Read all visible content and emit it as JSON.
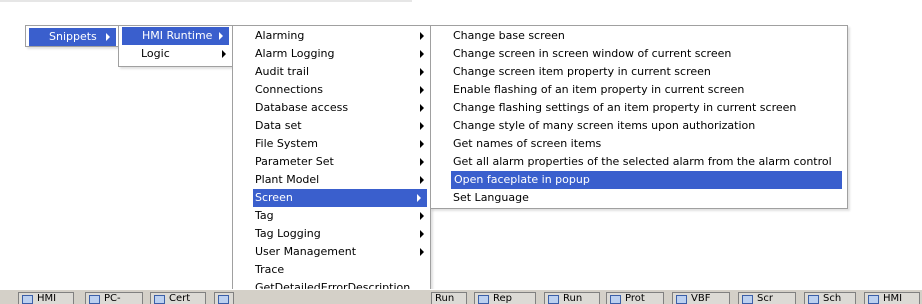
{
  "menus": {
    "snippets": {
      "label": "Snippets"
    },
    "hmi": {
      "items": [
        {
          "label": "HMI Runtime"
        },
        {
          "label": "Logic"
        }
      ]
    },
    "categories": {
      "items": [
        {
          "label": "Alarming"
        },
        {
          "label": "Alarm Logging"
        },
        {
          "label": "Audit trail"
        },
        {
          "label": "Connections"
        },
        {
          "label": "Database access"
        },
        {
          "label": "Data set"
        },
        {
          "label": "File System"
        },
        {
          "label": "Parameter Set"
        },
        {
          "label": "Plant Model"
        },
        {
          "label": "Screen"
        },
        {
          "label": "Tag"
        },
        {
          "label": "Tag Logging"
        },
        {
          "label": "User Management"
        },
        {
          "label": "Trace"
        },
        {
          "label": "GetDetailedErrorDescription"
        }
      ]
    },
    "screen_items": {
      "items": [
        {
          "label": "Change base screen"
        },
        {
          "label": "Change screen in screen window of current screen"
        },
        {
          "label": "Change screen item property in current screen"
        },
        {
          "label": "Enable flashing of an item property in current screen"
        },
        {
          "label": "Change flashing settings of an item property in current screen"
        },
        {
          "label": "Change style of many screen items upon authorization"
        },
        {
          "label": "Get names of screen items"
        },
        {
          "label": "Get all alarm properties of the selected alarm from the alarm control"
        },
        {
          "label": "Open faceplate in popup"
        },
        {
          "label": "Set Language"
        }
      ]
    }
  },
  "taskbar": {
    "buttons": [
      {
        "label": "HMI"
      },
      {
        "label": "PC-"
      },
      {
        "label": "Cert"
      },
      {
        "label": ""
      },
      {
        "label": "Run"
      },
      {
        "label": "Rep"
      },
      {
        "label": "Run"
      },
      {
        "label": "Prot"
      },
      {
        "label": "VBF"
      },
      {
        "label": "Scr"
      },
      {
        "label": "Sch"
      },
      {
        "label": "HMI"
      }
    ]
  },
  "colors": {
    "selection": "#3a5fcd",
    "menu_border": "#a0a0a0",
    "taskbar": "#d4d0c8"
  }
}
